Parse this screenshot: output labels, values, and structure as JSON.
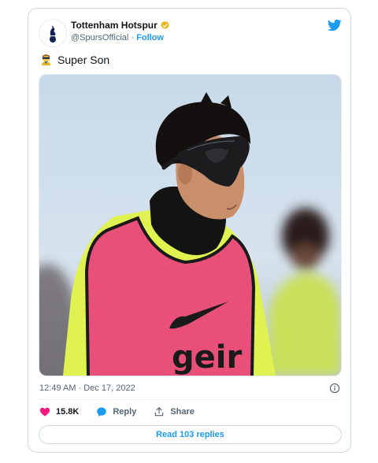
{
  "author": {
    "name": "Tottenham Hotspur",
    "handle": "@SpursOfficial",
    "separator": "·",
    "follow_label": "Follow",
    "avatar_icon": "spurs-cockerel-crest",
    "verified_icon": "verified-badge-gold"
  },
  "tweet": {
    "emoji_icon": "superhero-emoji",
    "text": "Super Son",
    "image_icon": "player-photo",
    "timestamp": "12:49 AM · Dec 17, 2022"
  },
  "actions": {
    "likes_count": "15.8K",
    "reply_label": "Reply",
    "share_label": "Share"
  },
  "read_replies_label": "Read 103 replies",
  "colors": {
    "accent": "#1d9bf0",
    "like": "#f91880",
    "text_secondary": "#536471",
    "border": "#cfd9de"
  }
}
